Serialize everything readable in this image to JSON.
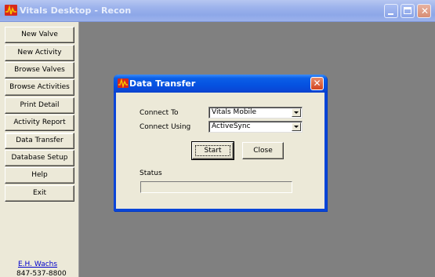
{
  "window": {
    "title": "Vitals Desktop - Recon",
    "logo_icon": "vitals-pulse-logo",
    "controls": {
      "minimize_icon": "minimize-icon",
      "maximize_icon": "maximize-icon",
      "close_icon": "close-icon",
      "close_glyph": "✕"
    }
  },
  "sidebar": {
    "items": [
      {
        "label": "New Valve"
      },
      {
        "label": "New Activity"
      },
      {
        "label": "Browse Valves"
      },
      {
        "label": "Browse Activities"
      },
      {
        "label": "Print Detail"
      },
      {
        "label": "Activity Report"
      },
      {
        "label": "Data Transfer",
        "active": true
      },
      {
        "label": "Database Setup"
      },
      {
        "label": "Help"
      },
      {
        "label": "Exit"
      }
    ],
    "company_link": "E.H. Wachs",
    "company_phone": "847-537-8800"
  },
  "dialog": {
    "title": "Data Transfer",
    "close_glyph": "✕",
    "connect_to_label": "Connect To",
    "connect_to_value": "Vitals Mobile",
    "connect_using_label": "Connect Using",
    "connect_using_value": "ActiveSync",
    "start_label": "Start",
    "close_label": "Close",
    "status_label": "Status",
    "status_progress": 0
  },
  "colors": {
    "desktop_bg": "#808080",
    "panel_bg": "#ece9d8",
    "dialog_title": "#0a52e0",
    "link": "#0000cc",
    "logo_red": "#d8281c",
    "logo_yellow": "#f4c400"
  }
}
